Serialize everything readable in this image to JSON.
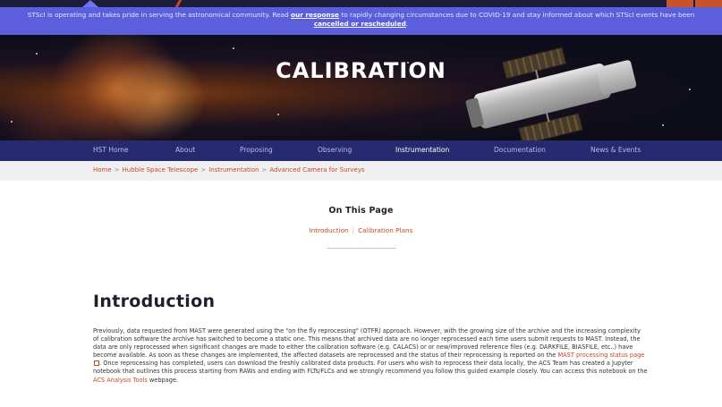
{
  "alert_banner": {
    "text_before": "STScI is operating and takes pride in serving the astronomical community. Read ",
    "response_link": "our response",
    "text_middle": " to rapidly changing circumstances due to COVID-19 and stay informed about which STScI events have been ",
    "events_link": "cancelled or rescheduled",
    "text_after": "."
  },
  "hero": {
    "title": "CALIBRATION"
  },
  "nav": {
    "items": [
      {
        "label": "HST Home"
      },
      {
        "label": "About"
      },
      {
        "label": "Proposing"
      },
      {
        "label": "Observing"
      },
      {
        "label": "Instrumentation"
      },
      {
        "label": "Documentation"
      },
      {
        "label": "News & Events"
      }
    ],
    "active": "Instrumentation"
  },
  "breadcrumb": {
    "items": [
      "Home",
      "Hubble Space Telescope",
      "Instrumentation",
      "Advanced Camera for Surveys"
    ],
    "separator": ">"
  },
  "on_this_page": {
    "heading": "On This Page",
    "links": [
      "Introduction",
      "Calibration Plans"
    ]
  },
  "introduction": {
    "heading": "Introduction",
    "p1": "Previously, data requested from MAST were generated using the \"on the fly reprocessing\" (OTFR) approach. However, with the growing size of the archive and the increasing complexity of calibration software the archive has switched to become a static one. This means that archived data are no longer reprocessed each time users submit requests to MAST. Instead, the data are only reprocessed when significant changes are made to either the calibration software (e.g. CALACS) or or new/improved reference files (e.g. DARKFILE, BIASFILE, etc..) have become available. As soon as these changes are implemented, the affected datasets are reprocessed and the status of their reprocessing is reported on the ",
    "mast_link": "MAST processing status page",
    "p2": ". Once reprocessing has completed, users can download the freshly calibrated data products. For users who wish to reprocess their data locally, the ACS Team has created a Jupyter notebook that outlines this process starting from RAWs and ending with FLTs/FLCs and we strongly recommend you follow this guided example closely. You can access this notebook on the ",
    "acs_link": "ACS Analysis Tools",
    "p3": " webpage."
  },
  "colors": {
    "banner": "#5b5fdb",
    "nav": "#262a6e",
    "link": "#c34a24",
    "breadcrumb_bg": "#f0f0f2"
  }
}
